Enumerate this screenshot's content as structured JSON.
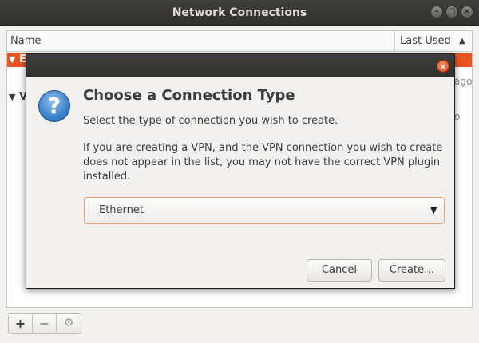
{
  "window": {
    "title": "Network Connections",
    "minimize": "–",
    "maximize": "□",
    "close": "×"
  },
  "list": {
    "columns": {
      "name": "Name",
      "last_used": "Last Used",
      "sort_arrow": "▲"
    },
    "rows": [
      {
        "expander": "▼",
        "label": "E",
        "selected": true
      },
      {
        "expander": "▼",
        "label": "V",
        "selected": false
      }
    ],
    "side_text": [
      "ago",
      "o"
    ]
  },
  "toolbar": {
    "add": "+",
    "remove": "−",
    "settings": "⚙"
  },
  "dialog": {
    "close": "×",
    "icon": "?",
    "heading": "Choose a Connection Type",
    "line1": "Select the type of connection you wish to create.",
    "paragraph": "If you are creating a VPN, and the VPN connection you wish to create does not appear in the list, you may not have the correct VPN plugin installed.",
    "combo": {
      "value": "Ethernet",
      "caret": "▼"
    },
    "buttons": {
      "cancel": "Cancel",
      "create": "Create…"
    }
  },
  "colors": {
    "accent": "#e95420",
    "titlebar": "#3c3b37",
    "question_blue": "#2f78c4"
  }
}
